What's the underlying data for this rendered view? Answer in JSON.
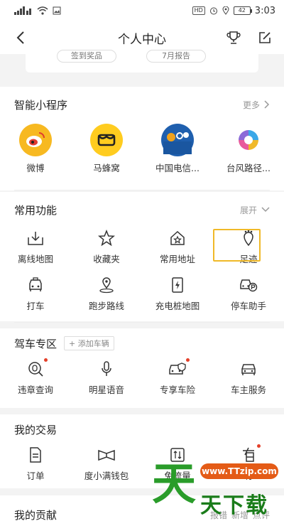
{
  "status_bar": {
    "hd": "HD",
    "battery": "42",
    "time": "3:03"
  },
  "nav": {
    "title": "个人中心"
  },
  "top_card": {
    "pill_1": "签到奖品",
    "pill_2": "7月报告"
  },
  "mini_programs": {
    "title": "智能小程序",
    "more": "更多",
    "items": [
      {
        "label": "微博",
        "icon": "weibo-icon",
        "color": "#f7b921"
      },
      {
        "label": "马蜂窝",
        "icon": "mafengwo-icon",
        "color": "#ffcc1f"
      },
      {
        "label": "中国电信...",
        "icon": "china-telecom-icon",
        "color": "#1f5fae"
      },
      {
        "label": "台风路径...",
        "icon": "typhoon-icon",
        "color": "#ffffff"
      }
    ]
  },
  "common": {
    "title": "常用功能",
    "expand": "展开",
    "row1": [
      {
        "label": "离线地图",
        "icon": "offline-map-icon"
      },
      {
        "label": "收藏夹",
        "icon": "star-icon"
      },
      {
        "label": "常用地址",
        "icon": "home-star-icon"
      },
      {
        "label": "足迹",
        "icon": "footprint-icon"
      }
    ],
    "row2": [
      {
        "label": "打车",
        "icon": "taxi-icon"
      },
      {
        "label": "跑步路线",
        "icon": "run-route-icon"
      },
      {
        "label": "充电桩地图",
        "icon": "charging-icon"
      },
      {
        "label": "停车助手",
        "icon": "parking-car-icon"
      }
    ]
  },
  "drive": {
    "title": "驾车专区",
    "add_car": "+ 添加车辆",
    "items": [
      {
        "label": "违章查询",
        "icon": "violation-icon",
        "dot": true
      },
      {
        "label": "明星语音",
        "icon": "microphone-icon",
        "dot": false
      },
      {
        "label": "专享车险",
        "icon": "car-insurance-icon",
        "dot": true
      },
      {
        "label": "车主服务",
        "icon": "car-service-icon",
        "dot": false
      }
    ]
  },
  "trade": {
    "title": "我的交易",
    "items": [
      {
        "label": "订单",
        "icon": "order-icon",
        "dot": false
      },
      {
        "label": "度小满钱包",
        "icon": "wallet-icon",
        "dot": false
      },
      {
        "label": "免流量",
        "icon": "data-icon",
        "dot": false
      },
      {
        "label": "有",
        "icon": "coupon-icon",
        "dot": true
      }
    ]
  },
  "contrib": {
    "title": "我的贡献",
    "links": [
      "报错",
      "新增",
      "点评"
    ]
  },
  "watermark": {
    "url": "www.TTzip.com",
    "big": "天",
    "text": "天下载"
  }
}
